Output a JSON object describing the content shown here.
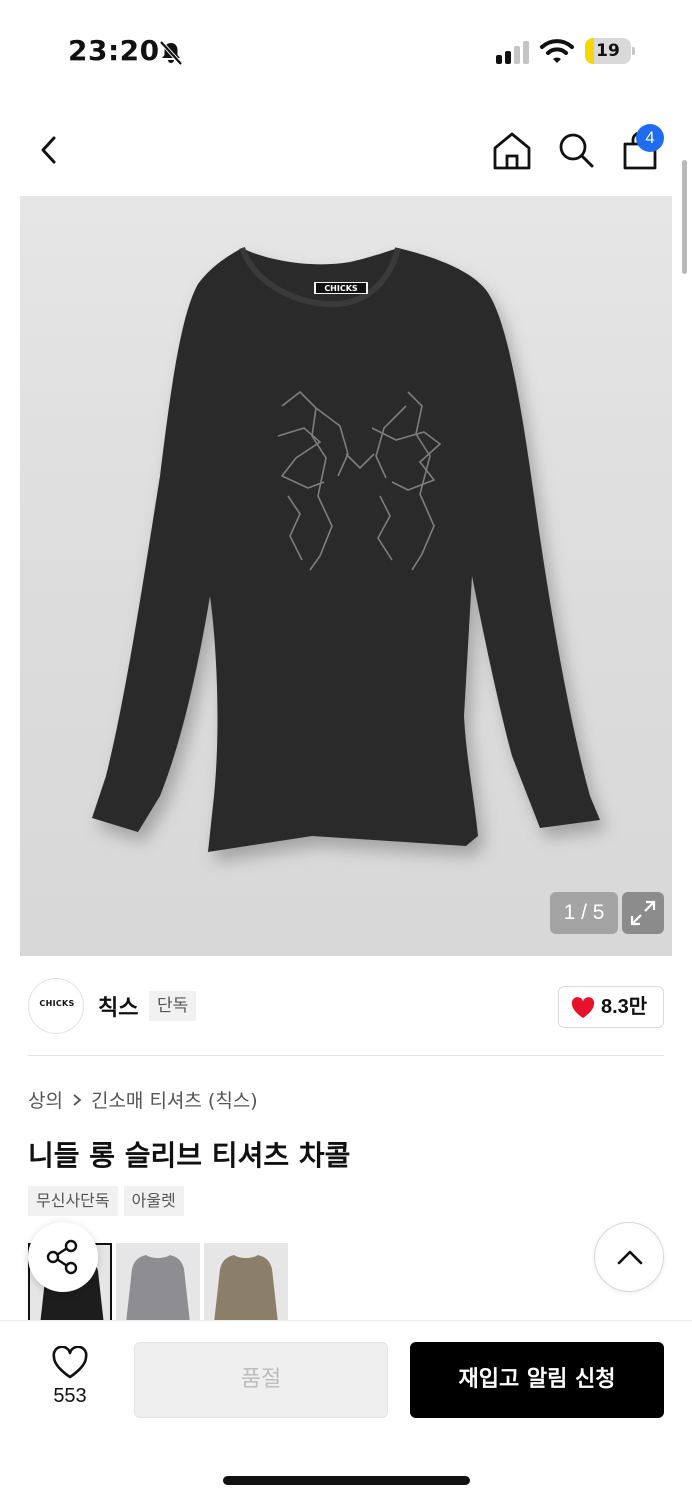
{
  "status_bar": {
    "time": "23:20",
    "battery_level": "19",
    "icons": [
      "bell-slash-icon",
      "cellular-signal-icon",
      "wifi-icon",
      "battery-icon"
    ]
  },
  "nav": {
    "icons": [
      "chevron-left-icon",
      "home-icon",
      "search-icon",
      "shopping-bag-icon"
    ],
    "cart_count": "4"
  },
  "gallery": {
    "counter": "1 / 5",
    "shirt_print_text": "CHICKS",
    "colors": {
      "background": "#dedede",
      "shirt": "#2b2b2b"
    }
  },
  "brand": {
    "logo_text": "CHICKS",
    "name": "칙스",
    "badge": "단독",
    "like_count": "8.3만",
    "heart_color": "#e8132b"
  },
  "product": {
    "breadcrumb": [
      "상의",
      "긴소매 티셔츠 (칙스)"
    ],
    "title": "니들 롱 슬리브 티셔츠 차콜",
    "tags": [
      "무신사단독",
      "아울렛"
    ],
    "color_thumbnails": [
      "charcoal",
      "gray",
      "beige"
    ]
  },
  "floating": {
    "icons": [
      "share-icon",
      "chevron-up-icon"
    ]
  },
  "bottom_bar": {
    "wish_count": "553",
    "soldout_label": "품절",
    "restock_label": "재입고 알림 신청",
    "accent": "#000000"
  }
}
